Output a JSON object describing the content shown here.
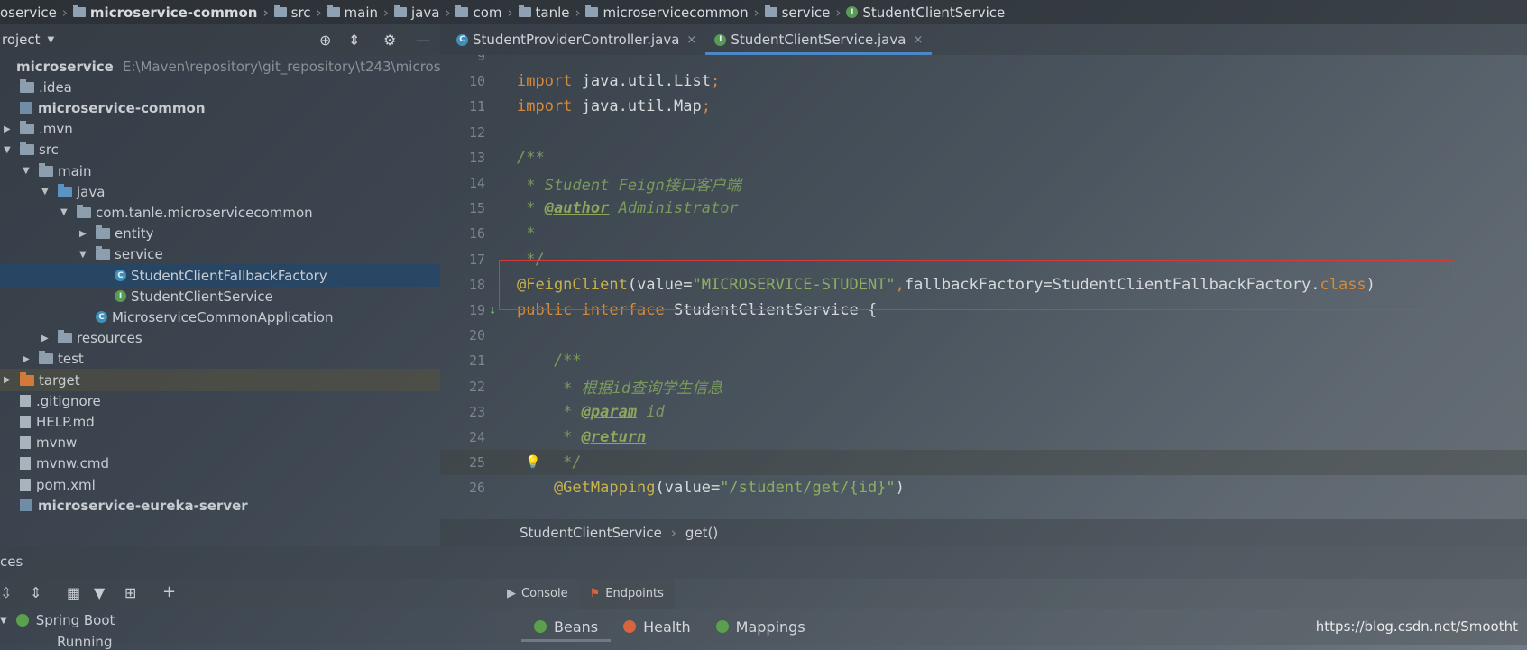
{
  "breadcrumb": [
    "oservice",
    "microservice-common",
    "src",
    "main",
    "java",
    "com",
    "tanle",
    "microservicecommon",
    "service",
    "StudentClientService"
  ],
  "project_panel": {
    "title": "roject",
    "tree": [
      {
        "label": "microservice",
        "path": "E:\\Maven\\repository\\git_repository\\t243\\microservi",
        "indent": 0,
        "arrow": "",
        "icon": "mod",
        "bold": true
      },
      {
        "label": ".idea",
        "indent": 0,
        "arrow": "",
        "icon": "fld"
      },
      {
        "label": "microservice-common",
        "indent": 0,
        "arrow": "",
        "icon": "mod",
        "bold": true
      },
      {
        "label": ".mvn",
        "indent": 0,
        "arrow": "▶",
        "icon": "fld"
      },
      {
        "label": "src",
        "indent": 0,
        "arrow": "▼",
        "icon": "fld"
      },
      {
        "label": "main",
        "indent": 1,
        "arrow": "▼",
        "icon": "fld"
      },
      {
        "label": "java",
        "indent": 2,
        "arrow": "▼",
        "icon": "fld-blue"
      },
      {
        "label": "com.tanle.microservicecommon",
        "indent": 3,
        "arrow": "▼",
        "icon": "fld"
      },
      {
        "label": "entity",
        "indent": 4,
        "arrow": "▶",
        "icon": "fld"
      },
      {
        "label": "service",
        "indent": 4,
        "arrow": "▼",
        "icon": "fld"
      },
      {
        "label": "StudentClientFallbackFactory",
        "indent": 5,
        "arrow": "",
        "icon": "class",
        "selected": true
      },
      {
        "label": "StudentClientService",
        "indent": 5,
        "arrow": "",
        "icon": "iface"
      },
      {
        "label": "MicroserviceCommonApplication",
        "indent": 4,
        "arrow": "",
        "icon": "class"
      },
      {
        "label": "resources",
        "indent": 2,
        "arrow": "▶",
        "icon": "fld"
      },
      {
        "label": "test",
        "indent": 1,
        "arrow": "▶",
        "icon": "fld"
      },
      {
        "label": "target",
        "indent": 0,
        "arrow": "▶",
        "icon": "fld-orange",
        "highlight": true
      },
      {
        "label": ".gitignore",
        "indent": 0,
        "arrow": "",
        "icon": "file"
      },
      {
        "label": "HELP.md",
        "indent": 0,
        "arrow": "",
        "icon": "file"
      },
      {
        "label": "mvnw",
        "indent": 0,
        "arrow": "",
        "icon": "file"
      },
      {
        "label": "mvnw.cmd",
        "indent": 0,
        "arrow": "",
        "icon": "file"
      },
      {
        "label": "pom.xml",
        "indent": 0,
        "arrow": "",
        "icon": "file"
      },
      {
        "label": "microservice-eureka-server",
        "indent": 0,
        "arrow": "",
        "icon": "mod",
        "bold": true
      }
    ]
  },
  "editor_tabs": [
    {
      "label": "StudentProviderController.java",
      "icon": "class-icon",
      "active": false
    },
    {
      "label": "StudentClientService.java",
      "icon": "interface-icon",
      "active": true
    }
  ],
  "editor_lines": [
    {
      "n": "9",
      "segs": []
    },
    {
      "n": "10",
      "segs": [
        [
          "kw",
          "import "
        ],
        [
          "plain",
          "java.util.List"
        ],
        [
          "kw",
          ";"
        ]
      ]
    },
    {
      "n": "11",
      "segs": [
        [
          "kw",
          "import "
        ],
        [
          "plain",
          "java.util.Map"
        ],
        [
          "kw",
          ";"
        ]
      ]
    },
    {
      "n": "12",
      "segs": []
    },
    {
      "n": "13",
      "segs": [
        [
          "cm",
          "/**"
        ]
      ]
    },
    {
      "n": "14",
      "segs": [
        [
          "cm",
          " * Student Feign接口客户端"
        ]
      ]
    },
    {
      "n": "15",
      "segs": [
        [
          "cm",
          " * "
        ],
        [
          "tag",
          "@author"
        ],
        [
          "cm",
          " Administrator"
        ]
      ]
    },
    {
      "n": "16",
      "segs": [
        [
          "cm",
          " *"
        ]
      ]
    },
    {
      "n": "17",
      "segs": [
        [
          "cm",
          " */"
        ]
      ]
    },
    {
      "n": "18",
      "segs": [
        [
          "ann",
          "@FeignClient"
        ],
        [
          "plain",
          "(value="
        ],
        [
          "str",
          "\"MICROSERVICE-STUDENT\""
        ],
        [
          "kw",
          ","
        ],
        [
          "plain",
          "fallbackFactory=StudentClientFallbackFactory."
        ],
        [
          "kw",
          "class"
        ],
        [
          "plain",
          ")"
        ]
      ]
    },
    {
      "n": "19",
      "segs": [
        [
          "kw",
          "public interface "
        ],
        [
          "plain",
          "StudentClientService {"
        ]
      ]
    },
    {
      "n": "20",
      "segs": []
    },
    {
      "n": "21",
      "segs": [
        [
          "cm",
          "    /**"
        ]
      ]
    },
    {
      "n": "22",
      "segs": [
        [
          "cm",
          "     * 根据id查询学生信息"
        ]
      ]
    },
    {
      "n": "23",
      "segs": [
        [
          "cm",
          "     * "
        ],
        [
          "tag",
          "@param"
        ],
        [
          "cm",
          " id"
        ]
      ]
    },
    {
      "n": "24",
      "segs": [
        [
          "cm",
          "     * "
        ],
        [
          "tag",
          "@return"
        ]
      ]
    },
    {
      "n": "25",
      "segs": [
        [
          "cm",
          "     */"
        ]
      ],
      "current": true
    },
    {
      "n": "26",
      "segs": [
        [
          "ann",
          "    @GetMapping"
        ],
        [
          "plain",
          "(value="
        ],
        [
          "str",
          "\"/student/get/{id}\""
        ],
        [
          "plain",
          ")"
        ]
      ]
    }
  ],
  "editor_breadcrumb": [
    "StudentClientService",
    "get()"
  ],
  "services_panel": {
    "title": "ces",
    "tree": [
      "Spring Boot",
      "Running"
    ],
    "tabs": [
      {
        "label": "Console",
        "active": false
      },
      {
        "label": "Endpoints",
        "active": true
      }
    ],
    "subtabs": [
      {
        "label": "Beans",
        "active": true,
        "color": "#5aa04f"
      },
      {
        "label": "Health",
        "active": false,
        "color": "#d9643d"
      },
      {
        "label": "Mappings",
        "active": false,
        "color": "#5aa04f"
      }
    ]
  },
  "watermark": "https://blog.csdn.net/Smootht"
}
